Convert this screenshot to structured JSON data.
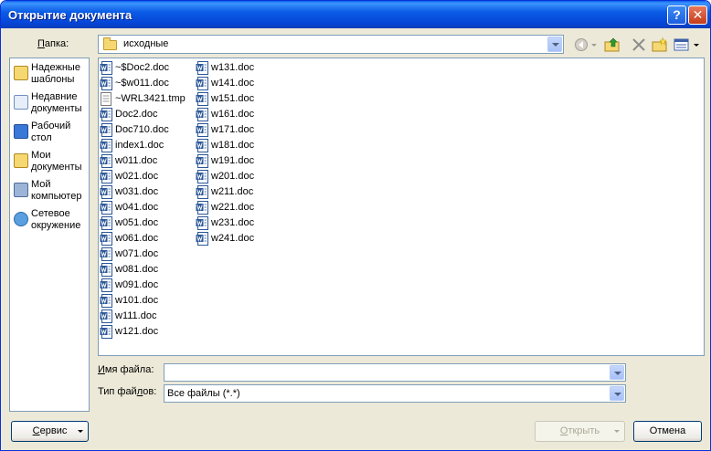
{
  "window": {
    "title": "Открытие документа"
  },
  "titlebar": {
    "help": "?",
    "close": "✕"
  },
  "lookin": {
    "label_pre": "",
    "label_u": "П",
    "label_post": "апка:",
    "value": "исходные"
  },
  "places": [
    {
      "label": "Надежные шаблоны",
      "icon": "trusted-templates-icon"
    },
    {
      "label": "Недавние документы",
      "icon": "recent-documents-icon"
    },
    {
      "label": "Рабочий стол",
      "icon": "desktop-icon"
    },
    {
      "label": "Мои документы",
      "icon": "my-documents-icon"
    },
    {
      "label": "Мой компьютер",
      "icon": "my-computer-icon"
    },
    {
      "label": "Сетевое окружение",
      "icon": "network-icon"
    }
  ],
  "files_col1": [
    "~$Doc2.doc",
    "~$w011.doc",
    "~WRL3421.tmp",
    "Doc2.doc",
    "Doc710.doc",
    "index1.doc",
    "w011.doc",
    "w021.doc",
    "w031.doc",
    "w041.doc",
    "w051.doc",
    "w061.doc",
    "w071.doc",
    "w081.doc",
    "w091.doc",
    "w101.doc",
    "w111.doc",
    "w121.doc"
  ],
  "files_col2": [
    "w131.doc",
    "w141.doc",
    "w151.doc",
    "w161.doc",
    "w171.doc",
    "w181.doc",
    "w191.doc",
    "w201.doc",
    "w211.doc",
    "w221.doc",
    "w231.doc",
    "w241.doc"
  ],
  "filename": {
    "label_u": "И",
    "label_post": "мя файла:",
    "value": ""
  },
  "filetype": {
    "label_pre": "Тип фай",
    "label_u": "л",
    "label_post": "ов:",
    "value": "Все файлы (*.*)"
  },
  "buttons": {
    "tools_u": "С",
    "tools_post": "ервис",
    "open_u": "О",
    "open_post": "ткрыть",
    "cancel": "Отмена"
  }
}
